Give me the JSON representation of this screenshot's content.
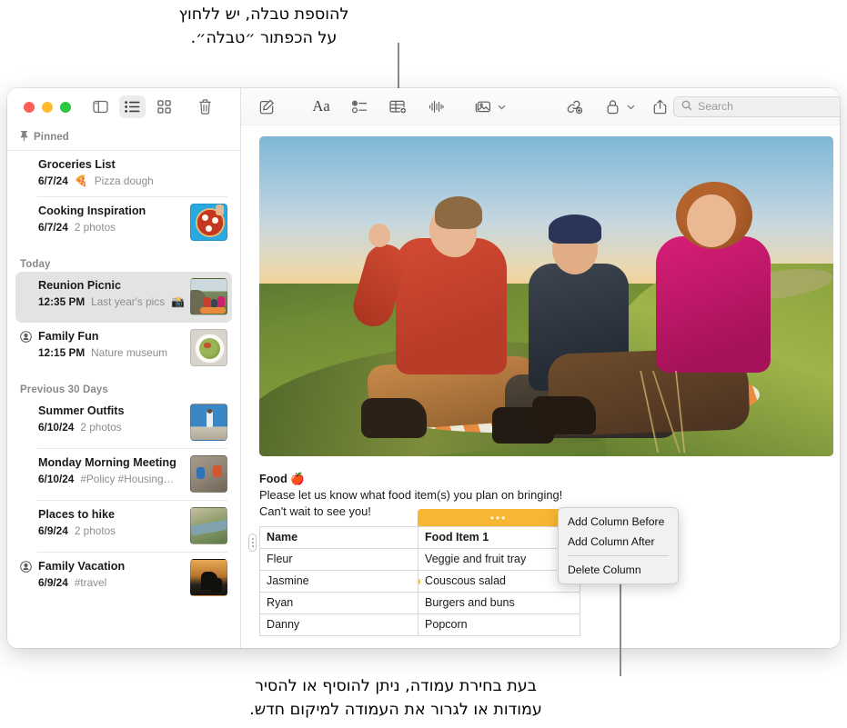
{
  "annotations": {
    "top": "להוספת טבלה, יש ללחוץ\nעל הכפתור ״טבלה״.",
    "bottom": "בעת בחירת עמודה, ניתן להוסיף או להסיר\nעמודות או לגרור את העמודה למיקום חדש."
  },
  "sidebar": {
    "toolbar": {
      "sidebar_toggle": "sidebar-toggle-icon",
      "list_view": "list-view-icon",
      "gallery_view": "gallery-view-icon",
      "delete": "trash-icon"
    },
    "sections": [
      {
        "label": "Pinned",
        "icon": "pin-icon",
        "items": [
          {
            "title": "Groceries List",
            "date": "6/7/24",
            "subtitle": "Pizza dough",
            "emoji": "🍕",
            "thumb": "none",
            "shared": false
          },
          {
            "title": "Cooking Inspiration",
            "date": "6/7/24",
            "subtitle": "2 photos",
            "emoji": "",
            "thumb": "pizza",
            "shared": false
          }
        ]
      },
      {
        "label": "Today",
        "icon": "",
        "items": [
          {
            "title": "Reunion Picnic",
            "date": "12:35 PM",
            "subtitle": "Last year's pics",
            "emoji": "📸",
            "thumb": "picnic",
            "shared": false,
            "selected": true
          },
          {
            "title": "Family Fun",
            "date": "12:15 PM",
            "subtitle": "Nature museum",
            "emoji": "",
            "thumb": "salad",
            "shared": true
          }
        ]
      },
      {
        "label": "Previous 30 Days",
        "icon": "",
        "items": [
          {
            "title": "Summer Outfits",
            "date": "6/10/24",
            "subtitle": "2 photos",
            "emoji": "",
            "thumb": "outfit",
            "shared": false
          },
          {
            "title": "Monday Morning Meeting",
            "date": "6/10/24",
            "subtitle": "#Policy #Housing…",
            "emoji": "",
            "thumb": "climb",
            "shared": false
          },
          {
            "title": "Places to hike",
            "date": "6/9/24",
            "subtitle": "2 photos",
            "emoji": "",
            "thumb": "river",
            "shared": false
          },
          {
            "title": "Family Vacation",
            "date": "6/9/24",
            "subtitle": "#travel",
            "emoji": "",
            "thumb": "sunset",
            "shared": true
          }
        ]
      }
    ]
  },
  "detail": {
    "toolbar": {
      "compose": "compose-icon",
      "format": "Aa",
      "checklist": "checklist-icon",
      "table": "table-icon",
      "audio": "audio-waveform-icon",
      "media": "media-icon",
      "link": "link-icon",
      "lock": "lock-icon",
      "share": "share-icon"
    },
    "search": {
      "placeholder": "Search",
      "value": "",
      "icon": "search-icon"
    },
    "note": {
      "heading": "Food 🍎",
      "paragraph_1": "Please let us know what food item(s) you plan on bringing!",
      "paragraph_2": "Can't wait to see you!"
    },
    "table": {
      "columns": [
        "Name",
        "Food Item 1"
      ],
      "rows": [
        [
          "Fleur",
          "Veggie and fruit tray"
        ],
        [
          "Jasmine",
          "Couscous salad"
        ],
        [
          "Ryan",
          "Burgers and buns"
        ],
        [
          "Danny",
          "Popcorn"
        ]
      ],
      "selected_column_index": 1,
      "selection_color": "#f7b733"
    }
  },
  "context_menu": {
    "items": [
      {
        "label": "Add Column Before"
      },
      {
        "label": "Add Column After"
      },
      {
        "label": "Delete Column"
      }
    ]
  }
}
